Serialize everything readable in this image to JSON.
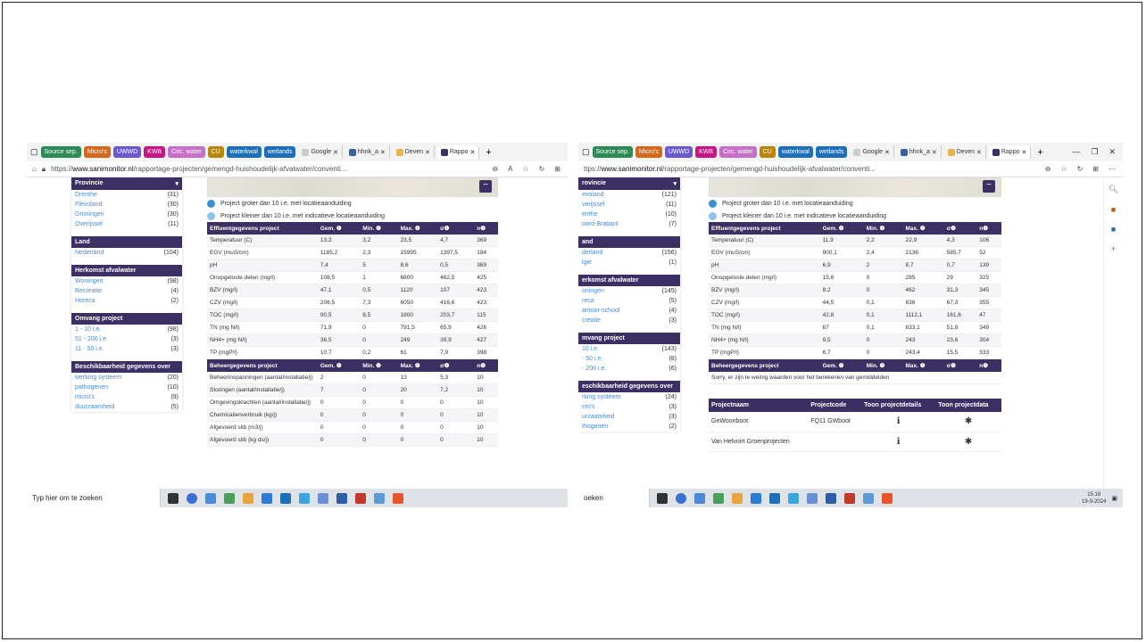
{
  "colors": {
    "header": "#3b2f63",
    "link": "#4a8ad6"
  },
  "favorites": [
    {
      "label": "Source sep.",
      "color": "#2e8b57"
    },
    {
      "label": "Micro's",
      "color": "#d2691e"
    },
    {
      "label": "UWWD",
      "color": "#6a5acd"
    },
    {
      "label": "KWB",
      "color": "#c71585"
    },
    {
      "label": "Circ. water",
      "color": "#c770c7"
    },
    {
      "label": "CU",
      "color": "#b8860b"
    },
    {
      "label": "waterkwal",
      "color": "#1e6fb8"
    },
    {
      "label": "wetlands",
      "color": "#1e6fb8"
    }
  ],
  "tabs": [
    "Google",
    "hhnk_a",
    "Deven",
    "Rappo"
  ],
  "left": {
    "url_prefix": "https://",
    "url_domain": "www.sanimonitor.nl",
    "url_path": "/rapportage-projecten/gemengd-huishoudelijk-afvalwater/conventi...",
    "taskbar_search": "Typ hier om te zoeken",
    "sections": [
      {
        "title": "Provincie",
        "items": [
          [
            "Drenthe",
            "(31)"
          ],
          [
            "Flevoland",
            "(30)"
          ],
          [
            "Groningen",
            "(30)"
          ],
          [
            "Overijssel",
            "(11)"
          ]
        ]
      },
      {
        "title": "Land",
        "items": [
          [
            "Nederland",
            "(104)"
          ]
        ]
      },
      {
        "title": "Herkomst afvalwater",
        "items": [
          [
            "Woningen",
            "(98)"
          ],
          [
            "Recreatie",
            "(4)"
          ],
          [
            "Horeca",
            "(2)"
          ]
        ]
      },
      {
        "title": "Omvang project",
        "items": [
          [
            "1 - 10 i.e.",
            "(98)"
          ],
          [
            "51 - 200 i.e.",
            "(3)"
          ],
          [
            "11 - 50 i.e.",
            "(3)"
          ]
        ]
      },
      {
        "title": "Beschikbaarheid gegevens over",
        "items": [
          [
            "werking systeem",
            "(20)"
          ],
          [
            "pathogenen",
            "(10)"
          ],
          [
            "micro's",
            "(9)"
          ],
          [
            "duurzaamheid",
            "(5)"
          ]
        ]
      }
    ],
    "effluent": [
      [
        "Temperatuur (C)",
        "13,3",
        "3,2",
        "23,5",
        "4,7",
        "369"
      ],
      [
        "EGV (muS/cm)",
        "1185,2",
        "2,3",
        "15995",
        "1397,5",
        "184"
      ],
      [
        "pH",
        "7,4",
        "5",
        "8,6",
        "0,5",
        "369"
      ],
      [
        "Onopgeloste delen (mg/l)",
        "108,5",
        "1",
        "6800",
        "462,5",
        "425"
      ],
      [
        "BZV (mg/l)",
        "47,1",
        "0,5",
        "1120",
        "107",
        "423"
      ],
      [
        "CZV (mg/l)",
        "206,5",
        "7,3",
        "6050",
        "416,6",
        "423"
      ],
      [
        "TOC (mg/l)",
        "90,5",
        "8,5",
        "1800",
        "203,7",
        "115"
      ],
      [
        "TN (mg N/l)",
        "71,9",
        "0",
        "791,5",
        "65,9",
        "426"
      ],
      [
        "NH4+ (mg N/l)",
        "36,5",
        "0",
        "249",
        "39,9",
        "427"
      ],
      [
        "TP (mgP/l)",
        "10,7",
        "0,2",
        "61",
        "7,9",
        "398"
      ]
    ],
    "beheer": [
      [
        "Beheerinspanningen (aantal/installatie/j)",
        "2",
        "0",
        "13",
        "5,3",
        "10"
      ],
      [
        "Storingen (aantal/installatie/j)",
        "7",
        "0",
        "20",
        "7,2",
        "10"
      ],
      [
        "Omgevingsklachten (aantal/installatie/j)",
        "0",
        "0",
        "0",
        "0",
        "10"
      ],
      [
        "Chemicalienverbruik (kg/j)",
        "0",
        "0",
        "0",
        "0",
        "10"
      ],
      [
        "Afgevoerd slib (m3/j)",
        "0",
        "0",
        "0",
        "0",
        "10"
      ],
      [
        "Afgevoerd slib (kg ds/j)",
        "0",
        "0",
        "0",
        "0",
        "10"
      ]
    ]
  },
  "right": {
    "url_prefix": "ttps://",
    "url_domain": "www.sanimonitor.nl",
    "url_path": "/rapportage-projecten/gemengd-huishoudelijk-afvalwater/conventi...",
    "taskbar_search": "oeken",
    "time": "15:18",
    "date": "19-9-2024",
    "sections": [
      {
        "title": "rovincie",
        "items": [
          [
            "evoland",
            "(121)"
          ],
          [
            "verijssel",
            "(11)"
          ],
          [
            "enthe",
            "(10)"
          ],
          [
            "oord-Brabant",
            "(7)"
          ]
        ]
      },
      {
        "title": "and",
        "items": [
          [
            "derland",
            "(156)"
          ],
          [
            "lgie",
            "(1)"
          ]
        ]
      },
      {
        "title": "erkomst afvalwater",
        "items": [
          [
            "oningen",
            "(145)"
          ],
          [
            "reca",
            "(5)"
          ],
          [
            "antoor-school",
            "(4)"
          ],
          [
            "creatie",
            "(3)"
          ]
        ]
      },
      {
        "title": "mvang project",
        "items": [
          [
            "10 i.e.",
            "(143)"
          ],
          [
            "- 50 i.e.",
            "(8)"
          ],
          [
            "- 200 i.e.",
            "(6)"
          ]
        ]
      },
      {
        "title": "eschikbaarheid gegevens over",
        "items": [
          [
            "rking systeem",
            "(24)"
          ],
          [
            "cro's",
            "(3)"
          ],
          [
            "urzaamheid",
            "(3)"
          ],
          [
            "thogenen",
            "(2)"
          ]
        ]
      }
    ],
    "effluent": [
      [
        "Temperatuur (C)",
        "11,9",
        "2,2",
        "22,9",
        "4,3",
        "106"
      ],
      [
        "EGV (muS/cm)",
        "900,1",
        "2,4",
        "2136",
        "585,7",
        "52"
      ],
      [
        "pH",
        "6,9",
        "2",
        "8,7",
        "0,7",
        "139"
      ],
      [
        "Onopgeloste delen (mg/l)",
        "15,6",
        "0",
        "285",
        "29",
        "325"
      ],
      [
        "BZV (mg/l)",
        "8,2",
        "0",
        "462",
        "31,3",
        "345"
      ],
      [
        "CZV (mg/l)",
        "44,5",
        "0,1",
        "836",
        "67,3",
        "355"
      ],
      [
        "TOC (mg/l)",
        "42,8",
        "0,1",
        "1112,1",
        "161,6",
        "47"
      ],
      [
        "TN (mg N/l)",
        "67",
        "0,1",
        "633,1",
        "51,8",
        "349"
      ],
      [
        "NH4+ (mg N/l)",
        "9,5",
        "0",
        "243",
        "23,6",
        "304"
      ],
      [
        "TP (mgP/l)",
        "6,7",
        "0",
        "243,4",
        "15,5",
        "333"
      ]
    ],
    "beheer_message": "Sorry, er zijn te weinig waarden voor het berekenen van gemiddelden",
    "projects_head": [
      "Projectnaam",
      "Projectcode",
      "Toon projectdetails",
      "Toon projectdata"
    ],
    "projects": [
      [
        "GeWoonboot",
        "FQ11 GWboot",
        "ℹ",
        "✱"
      ],
      [
        "Van Helvoirt Groenprojecten",
        "",
        "ℹ",
        "✱"
      ]
    ]
  },
  "legend": {
    "large": "Project groter dan 10 i.e. met locatieaanduiding",
    "small": "Project kleiner dan 10 i.e. met indicatieve locatieaanduiding"
  },
  "table_heads": {
    "effluent": "Effluentgegevens project",
    "beheer": "Beheergegevens project",
    "cols": [
      "Gem. ❶",
      "Min. ❶",
      "Max. ❶",
      "σ❶",
      "n❶"
    ]
  }
}
